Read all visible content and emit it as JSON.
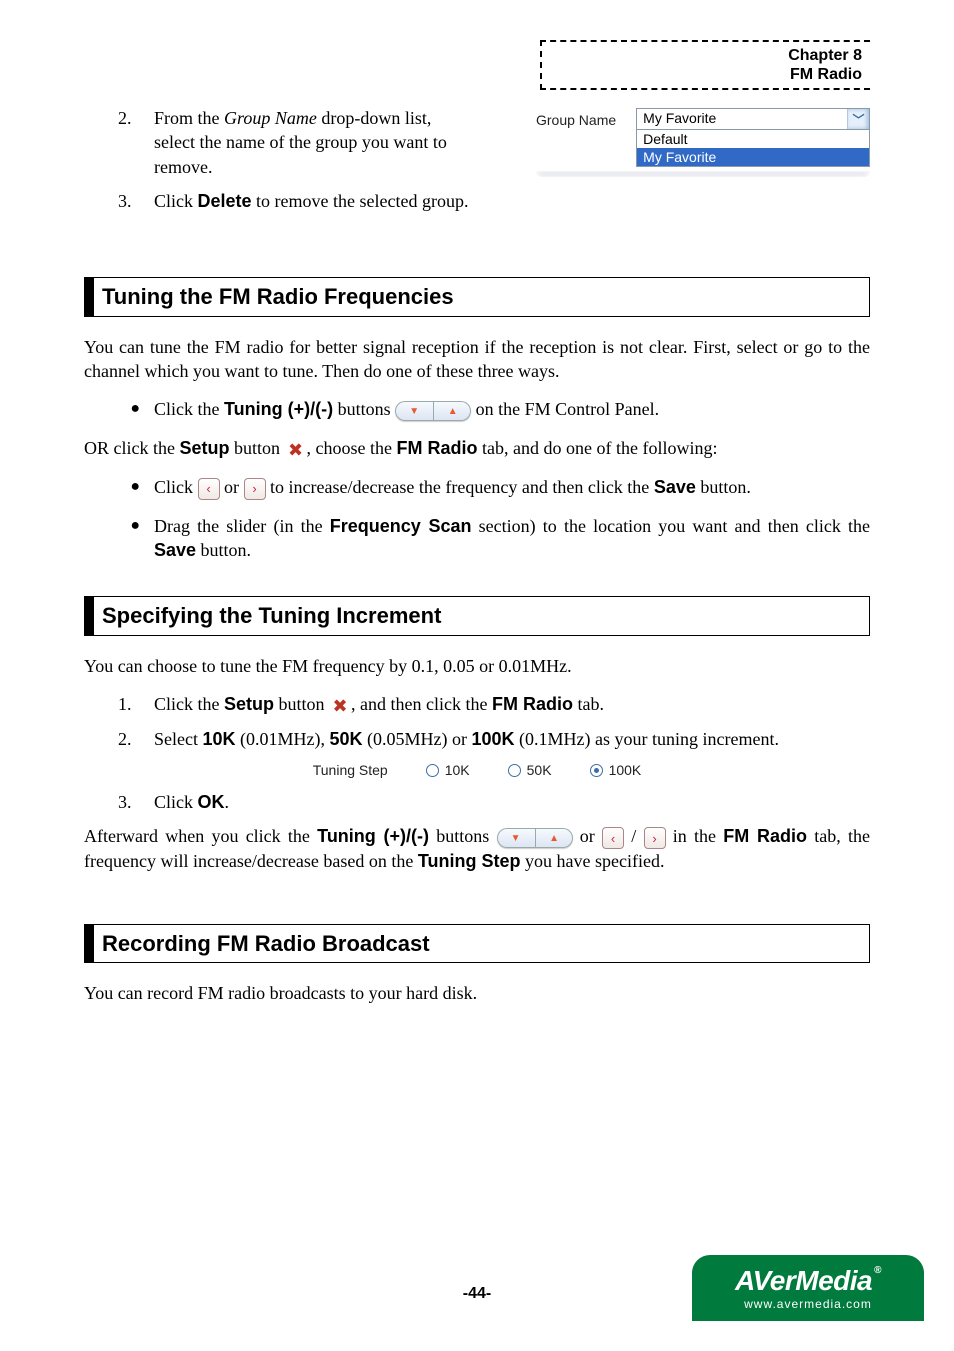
{
  "chapter": {
    "line1": "Chapter 8",
    "line2": "FM Radio"
  },
  "groupname_widget": {
    "label": "Group Name",
    "selected": "My Favorite",
    "options": [
      "Default",
      "My Favorite"
    ]
  },
  "steps_top": {
    "s2": {
      "num": "2.",
      "pre": "From the ",
      "italic": "Group Name",
      "post": " drop-down list, select the name of the group you want to remove."
    },
    "s3": {
      "num": "3.",
      "pre": "Click ",
      "bold": "Delete",
      "post": " to remove the selected group."
    }
  },
  "section1": {
    "title": "Tuning the FM Radio Frequencies",
    "intro": "You can tune the FM radio for better signal reception if the reception is not clear. First, select or go to the channel which you want to tune. Then do one of these three ways.",
    "b1": {
      "pre": "Click the ",
      "bold": "Tuning (+)/(-)",
      "mid": " buttons ",
      "post": " on the FM Control Panel."
    },
    "or_line": {
      "pre": "OR click the ",
      "bold1": "Setup",
      "mid1": " button ",
      "mid2": ", choose the ",
      "bold2": "FM Radio",
      "post": " tab, and do one of the following:"
    },
    "b2": {
      "pre": "Click ",
      "mid": " or ",
      "mid2": " to increase/decrease the frequency and then click the ",
      "bold": "Save",
      "post": " button."
    },
    "b3": {
      "pre": "Drag the slider (in the ",
      "bold1": "Frequency Scan",
      "mid": " section) to the location you want and then click the ",
      "bold2": "Save",
      "post": " button."
    }
  },
  "section2": {
    "title": "Specifying the Tuning Increment",
    "intro": "You can choose to tune the FM frequency by 0.1, 0.05 or 0.01MHz.",
    "s1": {
      "num": "1.",
      "pre": "Click the ",
      "bold1": "Setup",
      "mid1": " button ",
      "mid2": ", and then click the ",
      "bold2": "FM Radio",
      "post": " tab."
    },
    "s2": {
      "num": "2.",
      "pre": "Select ",
      "b1": "10K",
      "p1": " (0.01MHz), ",
      "b2": "50K",
      "p2": " (0.05MHz) or ",
      "b3": "100K",
      "p3": " (0.1MHz) as your tuning increment."
    },
    "tuning_step": {
      "label": "Tuning Step",
      "options": [
        "10K",
        "50K",
        "100K"
      ],
      "selected": 2
    },
    "s3": {
      "num": "3.",
      "pre": "Click ",
      "bold": "OK",
      "post": "."
    },
    "after": {
      "pre": "Afterward when you click the ",
      "bold1": "Tuning (+)/(-)",
      "mid1": " buttons ",
      "mid2": " or ",
      "slash": " / ",
      "mid3": " in the ",
      "bold2": "FM Radio",
      "mid4": " tab, the frequency will increase/decrease based on the ",
      "bold3": "Tuning Step",
      "post": " you have specified."
    }
  },
  "section3": {
    "title": "Recording FM Radio Broadcast",
    "intro": "You can record FM radio broadcasts to your hard disk."
  },
  "page_number": "-44-",
  "logo": {
    "main": "AVerMedia",
    "sub": "www.avermedia.com",
    "reg": "®"
  }
}
